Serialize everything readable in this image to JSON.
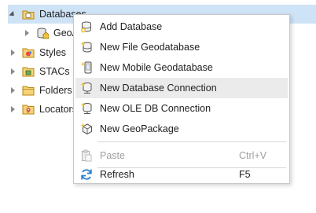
{
  "tree": {
    "items": [
      {
        "label": "Databases",
        "icon": "database-folder-icon",
        "expanded": true,
        "selected": true
      },
      {
        "label": "GeoA",
        "icon": "geodatabase-home-icon",
        "expanded": false
      },
      {
        "label": "Styles",
        "icon": "styles-icon",
        "expanded": false
      },
      {
        "label": "STACs",
        "icon": "stac-folder-icon",
        "expanded": false
      },
      {
        "label": "Folders",
        "icon": "folder-icon",
        "expanded": false
      },
      {
        "label": "Locators",
        "icon": "locators-icon",
        "expanded": false
      }
    ]
  },
  "context_menu": {
    "items": [
      {
        "label": "Add Database",
        "icon": "add-database-icon",
        "enabled": true
      },
      {
        "label": "New File Geodatabase",
        "icon": "new-file-geodatabase-icon",
        "enabled": true
      },
      {
        "label": "New Mobile Geodatabase",
        "icon": "new-mobile-geodatabase-icon",
        "enabled": true
      },
      {
        "label": "New Database Connection",
        "icon": "new-database-connection-icon",
        "enabled": true,
        "hovered": true
      },
      {
        "label": "New OLE DB Connection",
        "icon": "new-ole-db-connection-icon",
        "enabled": true
      },
      {
        "label": "New GeoPackage",
        "icon": "new-geopackage-icon",
        "enabled": true
      },
      {
        "label": "Paste",
        "shortcut": "Ctrl+V",
        "icon": "paste-icon",
        "enabled": false
      },
      {
        "label": "Refresh",
        "shortcut": "F5",
        "icon": "refresh-icon",
        "enabled": true
      }
    ]
  },
  "colors": {
    "selection": "#cfe3f6",
    "hover": "#ebebeb",
    "disabled_text": "#9e9e9e",
    "database_icon": "#b8860b",
    "refresh_icon": "#2a7fd4"
  }
}
